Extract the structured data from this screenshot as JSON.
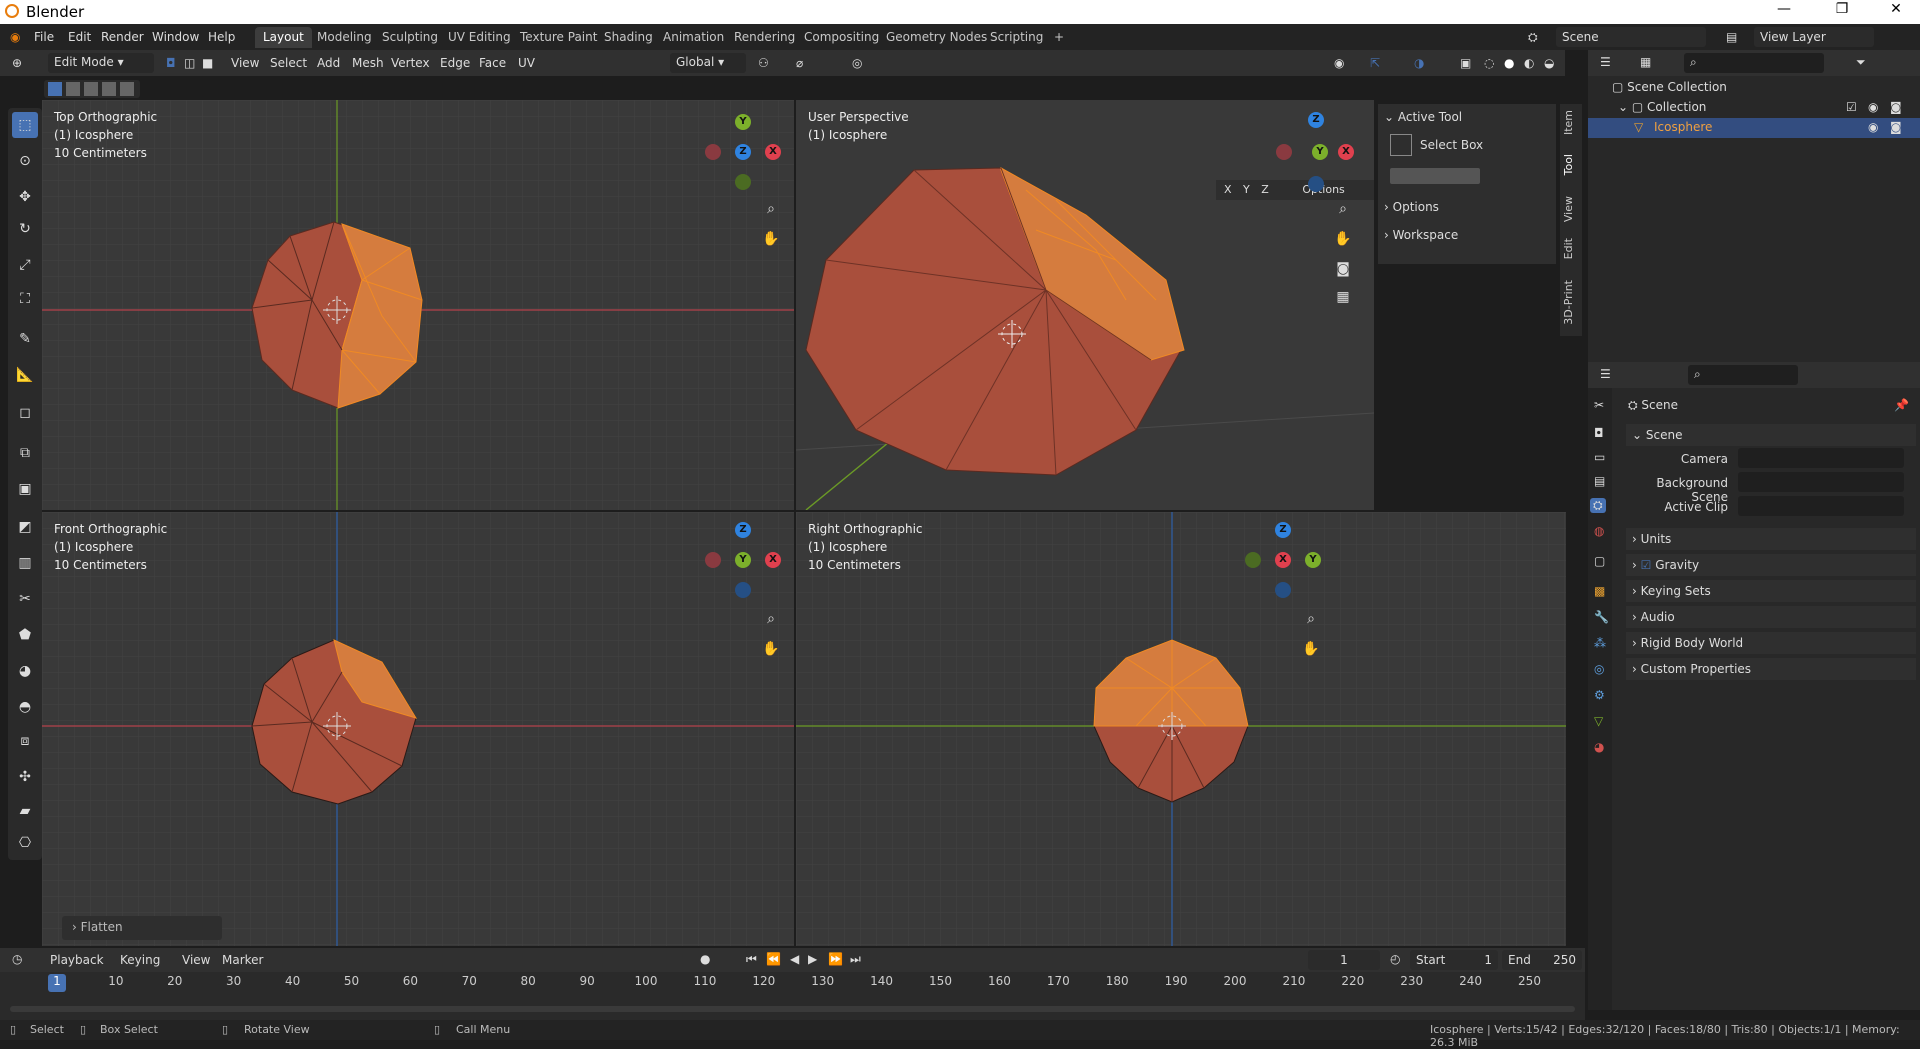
{
  "titlebar": {
    "title": "Blender",
    "minimize": "—",
    "maximize": "❐",
    "close": "✕"
  },
  "topbar": {
    "menus": [
      "File",
      "Edit",
      "Render",
      "Window",
      "Help"
    ],
    "workspaces": [
      "Layout",
      "Modeling",
      "Sculpting",
      "UV Editing",
      "Texture Paint",
      "Shading",
      "Animation",
      "Rendering",
      "Compositing",
      "Geometry Nodes",
      "Scripting"
    ],
    "active_workspace": "Layout",
    "add_workspace": "+",
    "scene_name": "Scene",
    "view_layer": "View Layer"
  },
  "viewport_header": {
    "mode": "Edit Mode",
    "menus": [
      "View",
      "Select",
      "Add",
      "Mesh",
      "Vertex",
      "Edge",
      "Face",
      "UV"
    ],
    "orientation": "Global",
    "options": "Options",
    "axes": [
      "X",
      "Y",
      "Z"
    ]
  },
  "views": {
    "top": {
      "title": "Top Orthographic",
      "object": "(1) Icosphere",
      "scale": "10 Centimeters"
    },
    "persp": {
      "title": "User Perspective",
      "object": "(1) Icosphere"
    },
    "front": {
      "title": "Front Orthographic",
      "object": "(1) Icosphere",
      "scale": "10 Centimeters"
    },
    "right": {
      "title": "Right Orthographic",
      "object": "(1) Icosphere",
      "scale": "10 Centimeters"
    }
  },
  "operator_panel": "Flatten",
  "npanel": {
    "active_tool": "Active Tool",
    "tool_name": "Select Box",
    "options": "Options",
    "workspace": "Workspace",
    "tabs": [
      "Item",
      "Tool",
      "View",
      "Edit",
      "3D-Print"
    ]
  },
  "outliner": {
    "scene_collection": "Scene Collection",
    "collection": "Collection",
    "object": "Icosphere"
  },
  "properties": {
    "breadcrumb": "Scene",
    "section_scene": "Scene",
    "camera_label": "Camera",
    "background_label": "Background Scene",
    "active_clip_label": "Active Clip",
    "panels": [
      "Units",
      "Gravity",
      "Keying Sets",
      "Audio",
      "Rigid Body World",
      "Custom Properties"
    ]
  },
  "timeline": {
    "menus": [
      "Playback",
      "Keying",
      "View",
      "Marker"
    ],
    "current_frame": "1",
    "start_label": "Start",
    "start": "1",
    "end_label": "End",
    "end": "250",
    "ticks": [
      "1",
      "10",
      "20",
      "30",
      "40",
      "50",
      "60",
      "70",
      "80",
      "90",
      "100",
      "110",
      "120",
      "130",
      "140",
      "150",
      "160",
      "170",
      "180",
      "190",
      "200",
      "210",
      "220",
      "230",
      "240",
      "250"
    ]
  },
  "status": {
    "select": "Select",
    "box_select": "Box Select",
    "rotate": "Rotate View",
    "call_menu": "Call Menu",
    "stats": "Icosphere | Verts:15/42 | Edges:32/120 | Faces:18/80 | Tris:80 | Objects:1/1 | Memory: 26.3 MiB"
  },
  "colors": {
    "accent": "#4772b3",
    "mesh": "#a94f3c",
    "selected": "#f08a24",
    "x_axis": "#e0404e",
    "y_axis": "#7cb02b",
    "z_axis": "#2f83e0"
  }
}
